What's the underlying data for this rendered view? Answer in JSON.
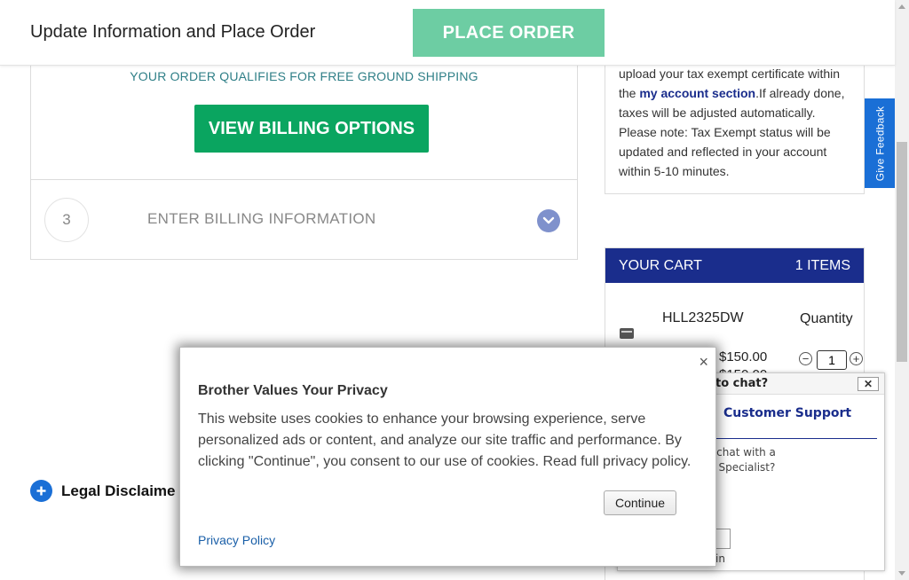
{
  "header": {
    "title": "Update Information and Place Order",
    "place_order_label": "PLACE ORDER"
  },
  "checkout": {
    "shipping_note": "YOUR ORDER QUALIFIES FOR FREE GROUND SHIPPING",
    "billing_button": "VIEW BILLING OPTIONS",
    "step_number": "3",
    "step_label": "ENTER BILLING INFORMATION"
  },
  "tax": {
    "line1": "upload your tax exempt certificate within",
    "prefix": "the ",
    "link": "my account section",
    "after_link": ".If already done,",
    "line3": "taxes will be adjusted automatically.",
    "line4": "Please note: Tax Exempt status will be",
    "line5": "updated and reflected in your account",
    "line6": "within 5-10 minutes."
  },
  "feedback": {
    "label": "Give Feedback"
  },
  "cart": {
    "title": "YOUR CART",
    "count": "1 ITEMS",
    "product": "HLL2325DW",
    "quantity_label": "Quantity",
    "price": "$150.00",
    "price_old": "$150.00",
    "quantity": "1"
  },
  "legal": {
    "label": "Legal Disclaime"
  },
  "chat": {
    "title": "to chat?",
    "close": "✕",
    "heading": "Customer Support",
    "question_line1": "o chat with a",
    "question_line2": "rt Specialist?",
    "footer": "in"
  },
  "privacy": {
    "close": "×",
    "title": "Brother Values Your Privacy",
    "body": "This website uses cookies to enhance your browsing experience, serve personalized ads or content, and analyze our site traffic and performance. By clicking \"Continue\", you consent to our use of cookies. Read full privacy policy.",
    "continue_label": "Continue",
    "policy_link": "Privacy Policy"
  },
  "colors": {
    "place_order_bg": "#6dcda3",
    "billing_btn_bg": "#0aa560",
    "cart_header_bg": "#1a2d8c",
    "feedback_bg": "#1a6fd6",
    "link": "#1a5fa8"
  },
  "icons": [
    "chevron-down-icon",
    "plus-circle-icon",
    "minus-icon",
    "plus-icon",
    "close-icon",
    "product-thumbnail-icon"
  ]
}
